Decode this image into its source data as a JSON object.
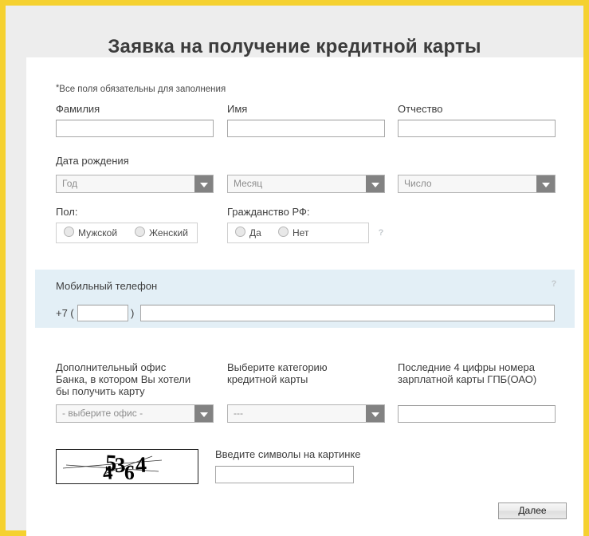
{
  "header": {
    "title": "Заявка на получение кредитной карты"
  },
  "form": {
    "required_note": "Все поля обязательны для заполнения",
    "required_star": "*",
    "name_row": {
      "last_name": {
        "label": "Фамилия",
        "value": "",
        "placeholder": ""
      },
      "first_name": {
        "label": "Имя",
        "value": "",
        "placeholder": ""
      },
      "middle_name": {
        "label": "Отчество",
        "value": "",
        "placeholder": ""
      }
    },
    "birth_date": {
      "label": "Дата рождения",
      "year": {
        "selected": "Год"
      },
      "month": {
        "selected": "Месяц"
      },
      "day": {
        "selected": "Число"
      }
    },
    "gender": {
      "label": "Пол:",
      "options": [
        {
          "label": "Мужской",
          "selected": false
        },
        {
          "label": "Женский",
          "selected": false
        }
      ]
    },
    "citizenship": {
      "label": "Гражданство РФ:",
      "options": [
        {
          "label": "Да",
          "selected": false
        },
        {
          "label": "Нет",
          "selected": false
        }
      ],
      "help": "?"
    },
    "phone": {
      "label": "Мобильный телефон",
      "prefix": "+7 (",
      "paren_close": ")",
      "area_code": {
        "value": "",
        "placeholder": ""
      },
      "number": {
        "value": "",
        "placeholder": ""
      },
      "help": "?"
    },
    "office": {
      "label": "Дополнительный офис Банка, в котором Вы хотели бы получить карту",
      "label_lines": [
        "Дополнительный офис",
        "Банка, в котором Вы хотели",
        "бы получить карту"
      ],
      "selected": "- выберите офис -"
    },
    "card_category": {
      "label": "Выберите категорию кредитной карты",
      "label_lines": [
        "Выберите категорию",
        "кредитной карты"
      ],
      "selected": "---"
    },
    "salary_card": {
      "label": "Последние 4 цифры номера зарплатной карты ГПБ(ОАО)",
      "label_lines": [
        "Последние 4 цифры номера",
        "зарплатной карты ГПБ(ОАО)"
      ],
      "value": "",
      "placeholder": ""
    },
    "captcha": {
      "image_text": "45364",
      "digits": [
        "4",
        "5",
        "3",
        "6",
        "4"
      ],
      "input_label": "Введите символы на картинке",
      "value": "",
      "placeholder": ""
    },
    "submit": {
      "label": "Далее"
    }
  },
  "colors": {
    "frame_yellow": "#f5d130",
    "band_gray": "#ededed",
    "card_white": "#ffffff",
    "phone_block_blue": "#e3eff6",
    "title_text": "#3c3c3c"
  }
}
